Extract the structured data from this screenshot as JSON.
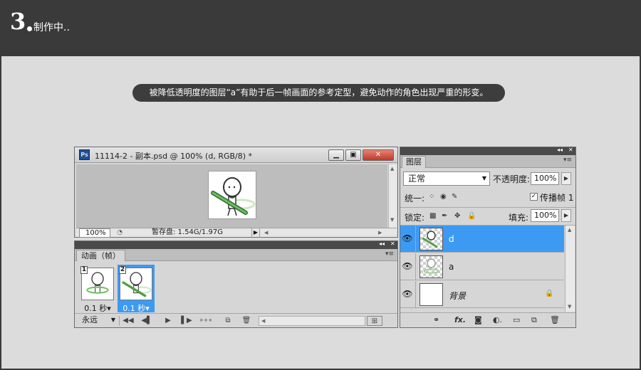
{
  "header": {
    "step_number": "3",
    "step_title": "制作中.."
  },
  "note": {
    "text": "被降低透明度的图层“a”有助于后一帧画面的参考定型，避免动作的角色出现严重的形变。"
  },
  "document_window": {
    "app_icon_label": "Ps",
    "title": "11114-2 - 副本.psd @ 100% (d, RGB/8) *",
    "zoom": "100%",
    "scratch_disk": "暂存盘: 1.54G/1.97G"
  },
  "animation_panel": {
    "tab_label": "动画（帧）",
    "frames": [
      {
        "number": "1",
        "delay": "0.1 秒▾",
        "selected": false
      },
      {
        "number": "2",
        "delay": "0.1 秒▾",
        "selected": true
      }
    ],
    "loop_label": "永远"
  },
  "layers_panel": {
    "tab_label": "图层",
    "blend_mode": "正常",
    "opacity_label": "不透明度:",
    "opacity_value": "100%",
    "unify_label": "统一:",
    "propagate_label": "传播帧 1",
    "lock_label": "锁定:",
    "fill_label": "填充:",
    "fill_value": "100%",
    "layers": [
      {
        "name": "d",
        "selected": true
      },
      {
        "name": "a",
        "selected": false
      },
      {
        "name": "背景",
        "selected": false,
        "locked": true
      }
    ]
  },
  "colors": {
    "header_bg": "#3a3a3a",
    "canvas_bg": "#dcdcdc",
    "selection_blue": "#3d9af2",
    "close_button": "#c0392b"
  },
  "icons": [
    "photoshop-app-icon",
    "minimize-icon",
    "maximize-icon",
    "close-icon",
    "eye-icon",
    "lock-icon",
    "link-icon",
    "fx-icon",
    "mask-icon",
    "adjustment-icon",
    "folder-icon",
    "new-layer-icon",
    "trash-icon",
    "play-icon",
    "rewind-icon"
  ]
}
